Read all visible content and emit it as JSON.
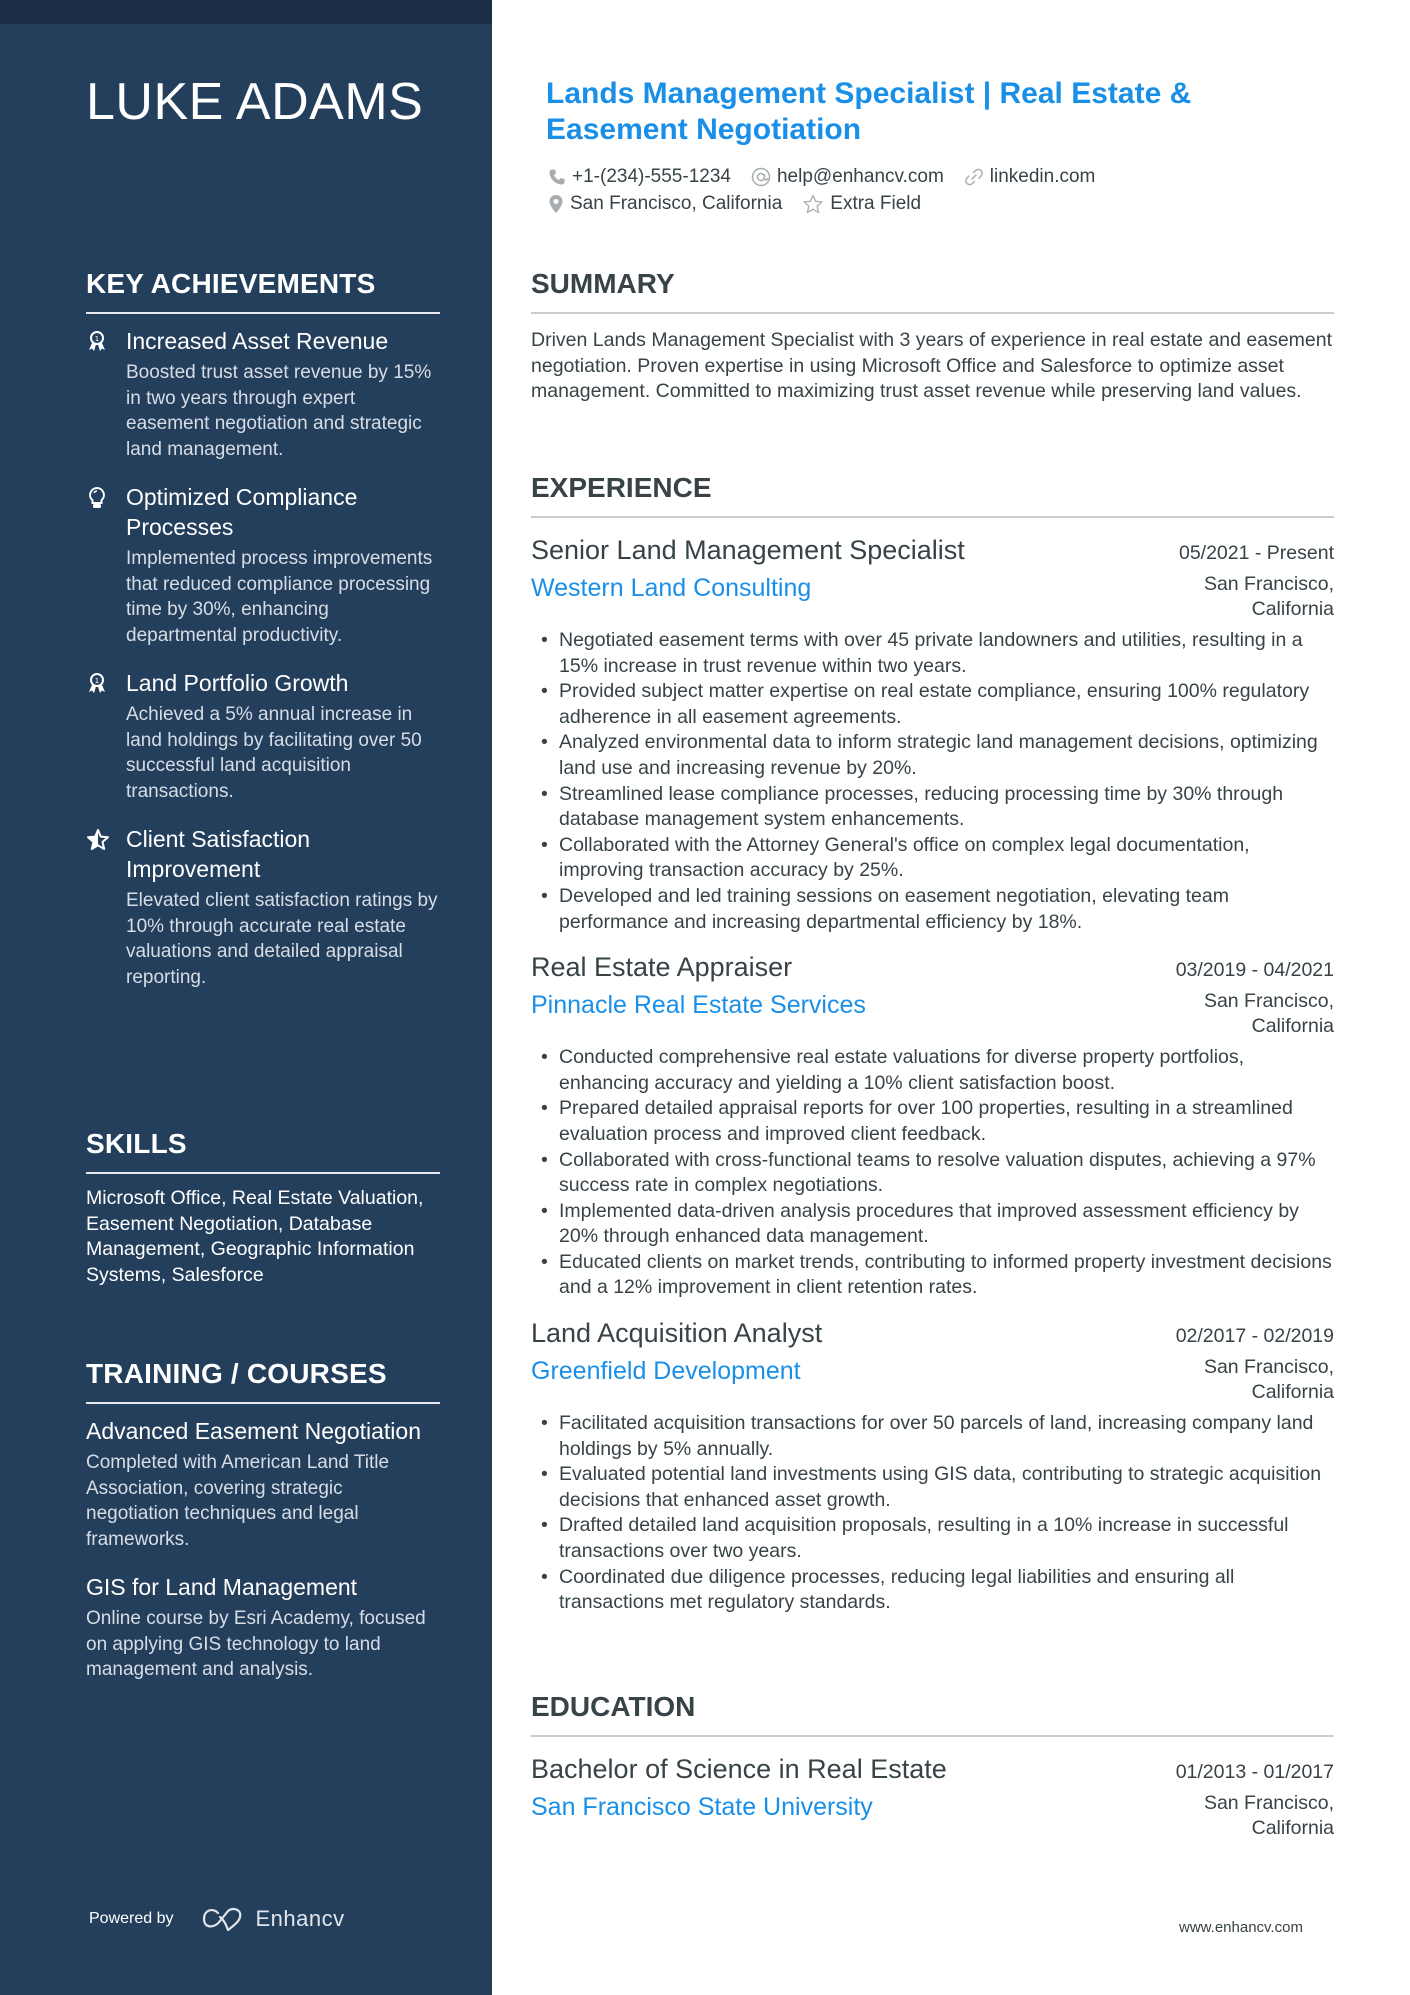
{
  "sidebar": {
    "name": "LUKE ADAMS",
    "key_achievements": {
      "heading": "KEY ACHIEVEMENTS",
      "items": [
        {
          "icon": "medal-icon",
          "title": "Increased Asset Revenue",
          "description": "Boosted trust asset revenue by 15% in two years through expert easement negotiation and strategic land management."
        },
        {
          "icon": "lightbulb-icon",
          "title": "Optimized Compliance Processes",
          "description": "Implemented process improvements that reduced compliance processing time by 30%, enhancing departmental productivity."
        },
        {
          "icon": "medal-icon",
          "title": "Land Portfolio Growth",
          "description": "Achieved a 5% annual increase in land holdings by facilitating over 50 successful land acquisition transactions."
        },
        {
          "icon": "star-half-icon",
          "title": "Client Satisfaction Improvement",
          "description": "Elevated client satisfaction ratings by 10% through accurate real estate valuations and detailed appraisal reporting."
        }
      ]
    },
    "skills": {
      "heading": "SKILLS",
      "text": "Microsoft Office, Real Estate Valuation, Easement Negotiation, Database Management, Geographic Information Systems, Salesforce"
    },
    "training": {
      "heading": "TRAINING / COURSES",
      "items": [
        {
          "title": "Advanced Easement Negotiation",
          "description": "Completed with American Land Title Association, covering strategic negotiation techniques and legal frameworks."
        },
        {
          "title": "GIS for Land Management",
          "description": "Online course by Esri Academy, focused on applying GIS technology to land management and analysis."
        }
      ]
    },
    "powered_by": "Powered by",
    "brand": "Enhancv"
  },
  "header": {
    "title": "Lands Management Specialist | Real Estate & Easement Negotiation",
    "contacts": {
      "phone": "+1-(234)-555-1234",
      "email": "help@enhancv.com",
      "link": "linkedin.com",
      "location": "San Francisco, California",
      "extra": "Extra Field"
    }
  },
  "summary": {
    "heading": "SUMMARY",
    "text": "Driven Lands Management Specialist with 3 years of experience in real estate and easement negotiation. Proven expertise in using Microsoft Office and Salesforce to optimize asset management. Committed to maximizing trust asset revenue while preserving land values."
  },
  "experience": {
    "heading": "EXPERIENCE",
    "jobs": [
      {
        "role": "Senior Land Management Specialist",
        "dates": "05/2021 - Present",
        "company": "Western Land Consulting",
        "location": "San Francisco, California",
        "bullets": [
          "Negotiated easement terms with over 45 private landowners and utilities, resulting in a 15% increase in trust revenue within two years.",
          "Provided subject matter expertise on real estate compliance, ensuring 100% regulatory adherence in all easement agreements.",
          "Analyzed environmental data to inform strategic land management decisions, optimizing land use and increasing revenue by 20%.",
          "Streamlined lease compliance processes, reducing processing time by 30% through database management system enhancements.",
          "Collaborated with the Attorney General's office on complex legal documentation, improving transaction accuracy by 25%.",
          "Developed and led training sessions on easement negotiation, elevating team performance and increasing departmental efficiency by 18%."
        ]
      },
      {
        "role": "Real Estate Appraiser",
        "dates": "03/2019 - 04/2021",
        "company": "Pinnacle Real Estate Services",
        "location": "San Francisco, California",
        "bullets": [
          "Conducted comprehensive real estate valuations for diverse property portfolios, enhancing accuracy and yielding a 10% client satisfaction boost.",
          "Prepared detailed appraisal reports for over 100 properties, resulting in a streamlined evaluation process and improved client feedback.",
          "Collaborated with cross-functional teams to resolve valuation disputes, achieving a 97% success rate in complex negotiations.",
          "Implemented data-driven analysis procedures that improved assessment efficiency by 20% through enhanced data management.",
          "Educated clients on market trends, contributing to informed property investment decisions and a 12% improvement in client retention rates."
        ]
      },
      {
        "role": "Land Acquisition Analyst",
        "dates": "02/2017 - 02/2019",
        "company": "Greenfield Development",
        "location": "San Francisco, California",
        "bullets": [
          "Facilitated acquisition transactions for over 50 parcels of land, increasing company land holdings by 5% annually.",
          "Evaluated potential land investments using GIS data, contributing to strategic acquisition decisions that enhanced asset growth.",
          "Drafted detailed land acquisition proposals, resulting in a 10% increase in successful transactions over two years.",
          "Coordinated due diligence processes, reducing legal liabilities and ensuring all transactions met regulatory standards."
        ]
      }
    ]
  },
  "education": {
    "heading": "EDUCATION",
    "items": [
      {
        "degree": "Bachelor of Science in Real Estate",
        "dates": "01/2013 - 01/2017",
        "school": "San Francisco State University",
        "location": "San Francisco, California"
      }
    ]
  },
  "footer": {
    "url": "www.enhancv.com"
  },
  "colors": {
    "sidebar_bg": "#243f5c",
    "sidebar_strip": "#1b2d44",
    "accent": "#1a8fe8",
    "text": "#384347"
  }
}
